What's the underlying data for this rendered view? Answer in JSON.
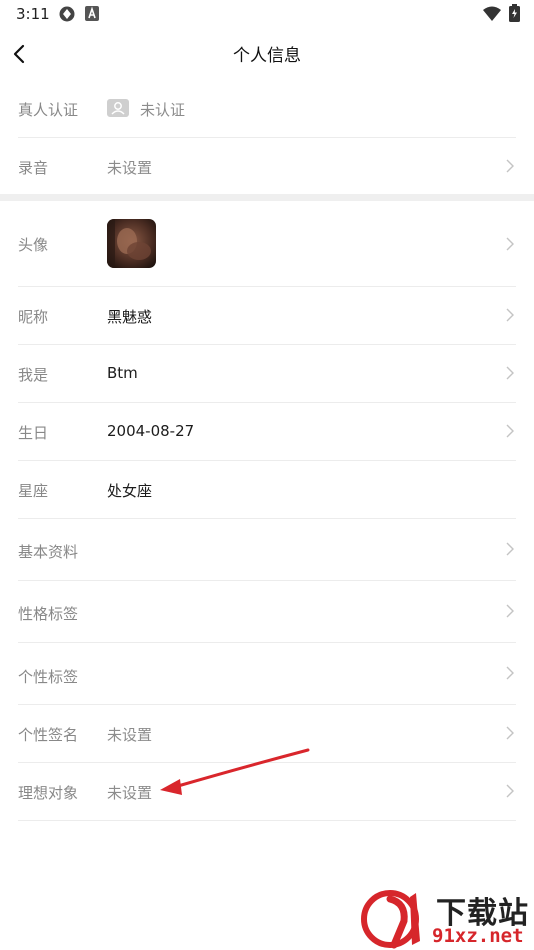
{
  "status_bar": {
    "time": "3:11"
  },
  "header": {
    "title": "个人信息"
  },
  "rows": {
    "verify": {
      "label": "真人认证",
      "value": "未认证"
    },
    "voice": {
      "label": "录音",
      "value": "未设置"
    },
    "avatar": {
      "label": "头像"
    },
    "nickname": {
      "label": "昵称",
      "value": "黑魅惑"
    },
    "iam": {
      "label": "我是",
      "value": "Btm"
    },
    "birthday": {
      "label": "生日",
      "value": "2004-08-27"
    },
    "zodiac": {
      "label": "星座",
      "value": "处女座"
    },
    "basic": {
      "label": "基本资料"
    },
    "character_tags": {
      "label": "性格标签"
    },
    "personal_tags": {
      "label": "个性标签"
    },
    "signature": {
      "label": "个性签名",
      "value": "未设置"
    },
    "ideal": {
      "label": "理想对象",
      "value": "未设置"
    }
  },
  "watermark": {
    "line1": "下载站",
    "line2": "91xz.net"
  },
  "colors": {
    "annotation_arrow": "#d9262c",
    "watermark_red": "#d6262b"
  }
}
